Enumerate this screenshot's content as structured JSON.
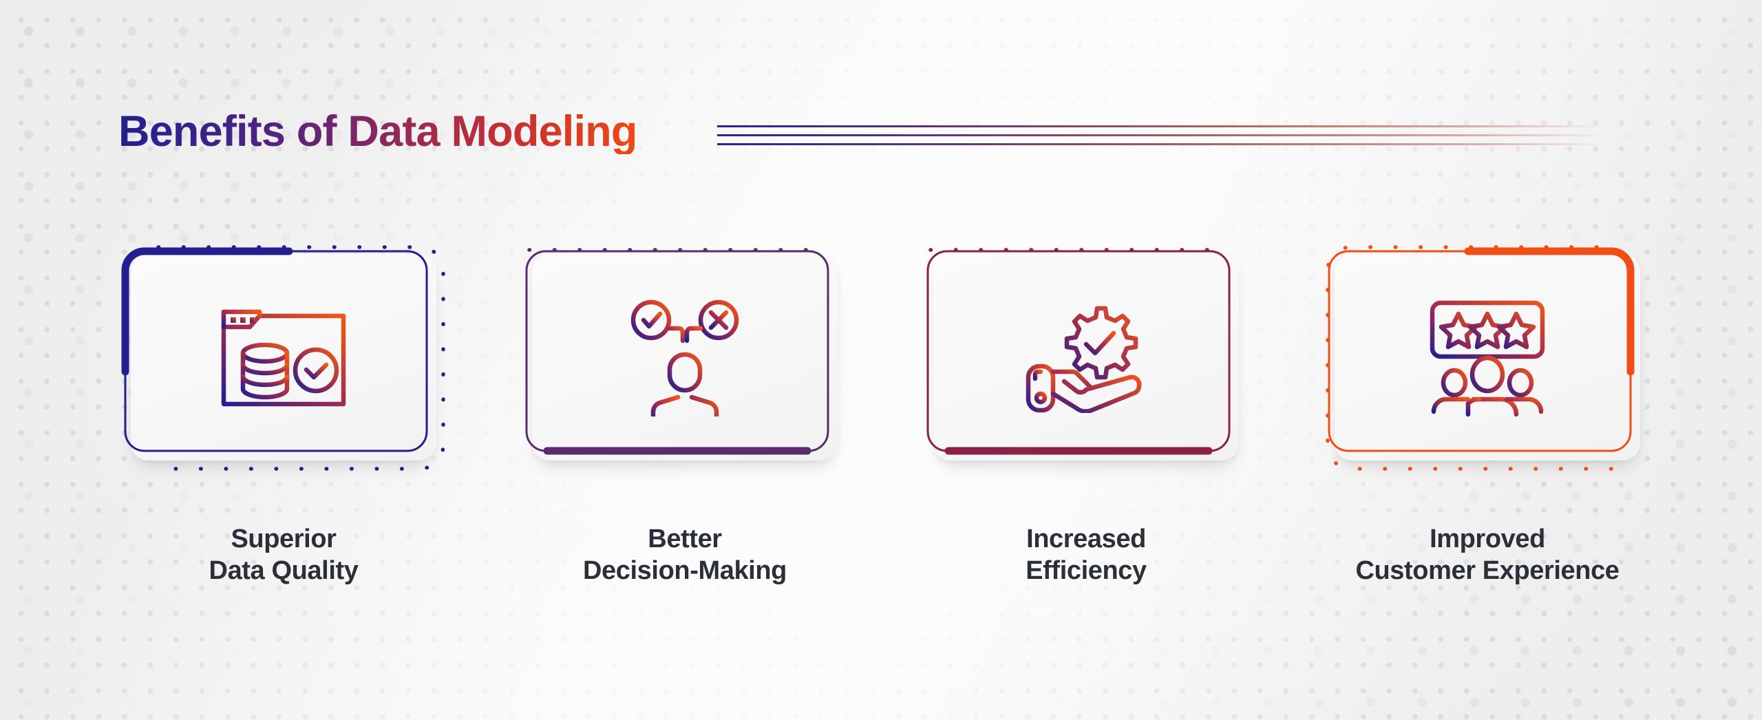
{
  "header": {
    "title": "Benefits of Data Modeling",
    "title_gradient_from": "#22208c",
    "title_gradient_to": "#ef4a15",
    "rule_count": 3
  },
  "cards": [
    {
      "id": "superior-data-quality",
      "label_line1": "Superior",
      "label_line2": "Data Quality",
      "accent_color": "#231f8f",
      "accent_position": "top-left",
      "dotted_position": "bottom-right",
      "icon_name": "database-window-check-icon",
      "icon_gradient_from": "#231f8f",
      "icon_gradient_to": "#f05a18"
    },
    {
      "id": "better-decision-making",
      "label_line1": "Better",
      "label_line2": "Decision-Making",
      "accent_color": "#5b2b6e",
      "accent_position": "bottom",
      "dotted_position": "top",
      "icon_name": "person-check-cross-decision-icon",
      "icon_gradient_from": "#2a2390",
      "icon_gradient_to": "#f0561a"
    },
    {
      "id": "increased-efficiency",
      "label_line1": "Increased",
      "label_line2": "Efficiency",
      "accent_color": "#8b2049",
      "accent_position": "bottom",
      "dotted_position": "top",
      "icon_name": "hand-gear-check-icon",
      "icon_gradient_from": "#2a2390",
      "icon_gradient_to": "#f0561a"
    },
    {
      "id": "improved-customer-experience",
      "label_line1": "Improved",
      "label_line2": "Customer Experience",
      "accent_color": "#f04e14",
      "accent_position": "top-right",
      "dotted_position": "bottom-left",
      "icon_name": "people-star-rating-icon",
      "icon_gradient_from": "#2a2390",
      "icon_gradient_to": "#f0561a"
    }
  ],
  "colors": {
    "background": "#f1f1f1",
    "label_text": "#2b2f38",
    "card_surface": "#f8f8f8"
  }
}
